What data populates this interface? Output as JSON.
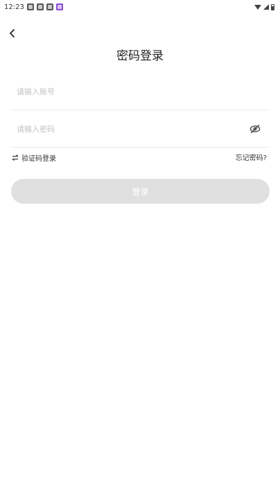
{
  "status_bar": {
    "time": "12:23",
    "notification_icons": [
      "app-icon",
      "app-icon",
      "app-icon",
      "gallery-icon"
    ],
    "right_icons": [
      "wifi-icon",
      "signal-icon",
      "battery-icon"
    ]
  },
  "header": {
    "title": "密码登录"
  },
  "form": {
    "account_placeholder": "请输入账号",
    "password_placeholder": "请输入密码",
    "account_value": "",
    "password_value": ""
  },
  "options": {
    "switch_label": "验证码登录",
    "forgot_label": "忘记密码?"
  },
  "login_button_label": "登录",
  "colors": {
    "button_disabled": "#e0e0e0",
    "divider": "#ececec",
    "placeholder": "#c2c2c2"
  }
}
